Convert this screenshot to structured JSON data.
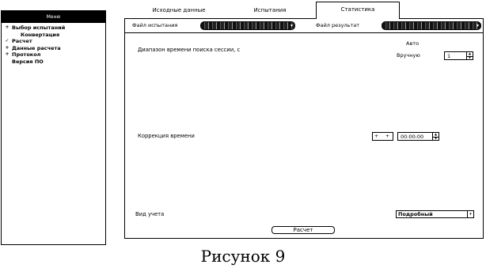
{
  "sidebar": {
    "header": "Меню",
    "items": [
      {
        "marker": "+",
        "label": "Выбор испытаний"
      },
      {
        "marker": "",
        "label": "Конвертация"
      },
      {
        "marker": "✓",
        "label": "Расчет"
      },
      {
        "marker": "+",
        "label": "Данные расчета"
      },
      {
        "marker": "+",
        "label": "Протокол"
      },
      {
        "marker": "",
        "label": "Версия ПО"
      }
    ]
  },
  "tabs": [
    {
      "label": "Исходные данные"
    },
    {
      "label": "Испытания"
    },
    {
      "label": "Статистика"
    }
  ],
  "filebar": {
    "test_file_label": "Файл испытания",
    "result_file_label": "Файл результат"
  },
  "params": {
    "session_range_label": "Диапазон времени поиска сессии, с",
    "auto_label": "Авто",
    "manual_label": "Вручную",
    "manual_value": "1",
    "time_correction_label": "Коррекция времени",
    "minus_label": "+",
    "plus_label": "+",
    "time_value": "00:00:00",
    "accounting_label": "Вид учета",
    "accounting_value": "Подробный"
  },
  "actions": {
    "calculate_label": "Расчет"
  },
  "caption": "Рисунок 9"
}
